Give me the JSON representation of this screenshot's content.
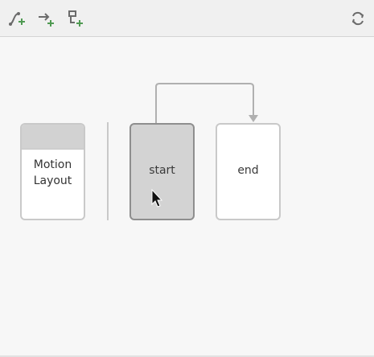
{
  "toolbar": {
    "left_icons": [
      "create-transition-icon",
      "create-click-handler-icon",
      "create-constraint-set-icon"
    ],
    "right_icon": "cycle-icon"
  },
  "overview": {
    "motion_layout": {
      "label": "Motion\nLayout"
    },
    "constraint_sets": [
      {
        "label": "start",
        "selected": true
      },
      {
        "label": "end",
        "selected": false
      }
    ],
    "transition": {
      "from": "start",
      "to": "end"
    }
  },
  "colors": {
    "toolbar_bg": "#f0f0f0",
    "icon_gray": "#6b6b6b",
    "icon_green": "#4f9a52",
    "selected_bg": "#d3d3d3",
    "selected_border": "#8e8e8e",
    "box_border": "#c9c9c9"
  }
}
